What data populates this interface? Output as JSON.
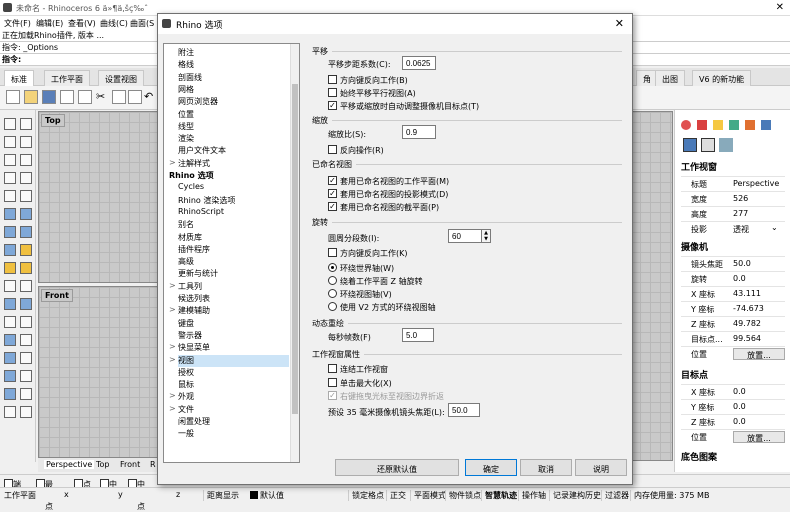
{
  "app": {
    "window_title": "未命名 - Rhinoceros 6 ä»¶ä,šç‰ˆ",
    "menus": [
      "文件(F)",
      "编辑(E)",
      "查看(V)",
      "曲线(C)",
      "曲面(S"
    ],
    "cmd_history": "指令: _Options",
    "cmd_prompt": "指令:",
    "top_partial": "正在加载Rhino插件, 版本 ..."
  },
  "tabs": [
    "标准",
    "工作平面",
    "设置视图",
    "出图",
    "V6 的新功能"
  ],
  "tab_partial": "角",
  "viewports": {
    "top": "Top",
    "front": "Front"
  },
  "viewport_tabs": [
    "Perspective",
    "Top",
    "Front",
    "R"
  ],
  "right_panel": {
    "section1": "工作视窗",
    "rows1": [
      {
        "k": "标题",
        "v": "Perspective"
      },
      {
        "k": "宽度",
        "v": "526"
      },
      {
        "k": "高度",
        "v": "277"
      },
      {
        "k": "投影",
        "v": "透视"
      }
    ],
    "section2": "摄像机",
    "rows2": [
      {
        "k": "镜头焦距",
        "v": "50.0"
      },
      {
        "k": "旋转",
        "v": "0.0"
      },
      {
        "k": "X 座标",
        "v": "43.111"
      },
      {
        "k": "Y 座标",
        "v": "-74.673"
      },
      {
        "k": "Z 座标",
        "v": "49.782"
      },
      {
        "k": "目标点...",
        "v": "99.564"
      },
      {
        "k": "位置",
        "v": "放置..."
      }
    ],
    "section3": "目标点",
    "rows3": [
      {
        "k": "X 座标",
        "v": "0.0"
      },
      {
        "k": "Y 座标",
        "v": "0.0"
      },
      {
        "k": "Z 座标",
        "v": "0.0"
      },
      {
        "k": "位置",
        "v": "放置..."
      }
    ],
    "section4": "底色图案"
  },
  "status": {
    "snaps": [
      "端点",
      "最近点",
      "点",
      "中点",
      "中心点"
    ],
    "bottom": [
      "工作平面",
      "x",
      "y",
      "z",
      "距离显示",
      "默认值",
      "锁定格点",
      "正交",
      "平面模式",
      "物件锁点",
      "智慧轨迹",
      "操作轴",
      "记录建构历史",
      "过滤器",
      "内存使用量: 375 MB"
    ]
  },
  "dialog": {
    "title": "Rhino 选项",
    "close": "✕",
    "tree": [
      {
        "label": "附注",
        "indent": 1
      },
      {
        "label": "格线",
        "indent": 1
      },
      {
        "label": "剖面线",
        "indent": 1
      },
      {
        "label": "网格",
        "indent": 1
      },
      {
        "label": "网页浏览器",
        "indent": 1
      },
      {
        "label": "位置",
        "indent": 1
      },
      {
        "label": "线型",
        "indent": 1
      },
      {
        "label": "渲染",
        "indent": 1
      },
      {
        "label": "用户文件文本",
        "indent": 1
      },
      {
        "label": "注解样式",
        "indent": 1,
        "arrow": ">"
      },
      {
        "label": "Rhino 选项",
        "indent": 0,
        "bold": true
      },
      {
        "label": "Cycles",
        "indent": 1
      },
      {
        "label": "Rhino 渲染选项",
        "indent": 1
      },
      {
        "label": "RhinoScript",
        "indent": 1
      },
      {
        "label": "别名",
        "indent": 1
      },
      {
        "label": "材质库",
        "indent": 1
      },
      {
        "label": "插件程序",
        "indent": 1
      },
      {
        "label": "高级",
        "indent": 1
      },
      {
        "label": "更新与统计",
        "indent": 1
      },
      {
        "label": "工具列",
        "indent": 1,
        "arrow": ">"
      },
      {
        "label": "候选列表",
        "indent": 1
      },
      {
        "label": "建模辅助",
        "indent": 1,
        "arrow": ">"
      },
      {
        "label": "键盘",
        "indent": 1
      },
      {
        "label": "警示器",
        "indent": 1
      },
      {
        "label": "快显菜单",
        "indent": 1,
        "arrow": ">"
      },
      {
        "label": "视图",
        "indent": 1,
        "arrow": ">",
        "selected": true
      },
      {
        "label": "授权",
        "indent": 1
      },
      {
        "label": "鼠标",
        "indent": 1
      },
      {
        "label": "外观",
        "indent": 1,
        "arrow": ">"
      },
      {
        "label": "文件",
        "indent": 1,
        "arrow": ">"
      },
      {
        "label": "闲置处理",
        "indent": 1
      },
      {
        "label": "一般",
        "indent": 1
      }
    ],
    "pan": {
      "header": "平移",
      "step_label": "平移步距系数(C):",
      "step_value": "0.0625",
      "options": [
        {
          "label": "方向键反向工作(B)",
          "checked": false
        },
        {
          "label": "始终平移平行视图(A)",
          "checked": false
        },
        {
          "label": "平移或缩放时自动调整摄像机目标点(T)",
          "checked": true
        }
      ]
    },
    "zoom": {
      "header": "缩放",
      "ratio_label": "缩放比(S):",
      "ratio_value": "0.9",
      "reverse_label": "反向操作(R)",
      "reverse_checked": false
    },
    "named": {
      "header": "已命名视图",
      "options": [
        {
          "label": "套用已命名视图的工作平面(M)",
          "checked": true
        },
        {
          "label": "套用已命名视图的投影模式(D)",
          "checked": true
        },
        {
          "label": "套用已命名视图的截平面(P)",
          "checked": true
        }
      ]
    },
    "rotate": {
      "header": "旋转",
      "circle_label": "圆周分段数(I):",
      "circle_value": "60",
      "reverse_label": "方向键反向工作(K)",
      "radios": [
        {
          "label": "环绕世界轴(W)",
          "checked": true
        },
        {
          "label": "绕着工作平面 Z 轴旋转",
          "checked": false
        },
        {
          "label": "环绕视图轴(V)",
          "checked": false
        },
        {
          "label": "使用 V2 方式的环绕视图轴",
          "checked": false
        }
      ]
    },
    "dynamic": {
      "header": "动态重绘",
      "fps_label": "每秒帧数(F)",
      "fps_value": "5.0"
    },
    "props": {
      "header": "工作视窗属性",
      "options": [
        {
          "label": "连结工作视窗",
          "checked": false,
          "disabled": false
        },
        {
          "label": "单击最大化(X)",
          "checked": false,
          "disabled": false
        },
        {
          "label": "右键拖曳光标至视图边界折返",
          "checked": true,
          "disabled": true
        }
      ],
      "lens_label": "预设 35 毫米摄像机镜头焦距(L):",
      "lens_value": "50.0"
    },
    "buttons": {
      "restore": "还原默认值",
      "ok": "确定",
      "cancel": "取消",
      "help": "说明"
    }
  }
}
